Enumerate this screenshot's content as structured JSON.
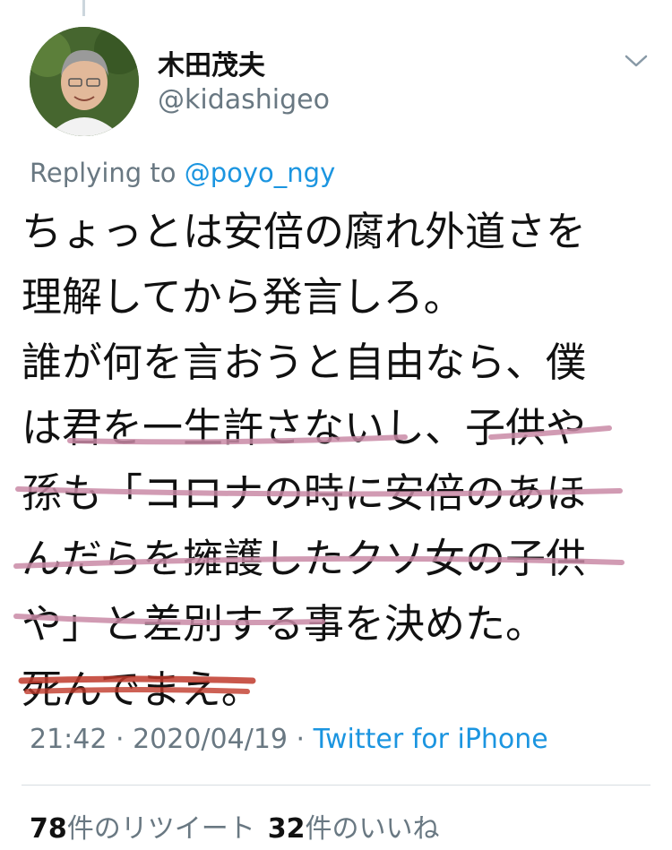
{
  "tweet": {
    "author": {
      "display_name": "木田茂夫",
      "handle": "@kidashigeo"
    },
    "reply": {
      "prefix": "Replying to ",
      "mention": "@poyo_ngy"
    },
    "lines": [
      "ちょっとは安倍の腐れ外道さを",
      "理解してから発言しろ。",
      "誰が何を言おうと自由なら、僕",
      "は君を一生許さないし、子供や",
      "孫も「コロナの時に安倍のあほ",
      "んだらを擁護したクソ女の子供",
      "や」と差別する事を決めた。",
      "死んでまえ。"
    ],
    "meta": {
      "time": "21:42",
      "sep": " · ",
      "date": "2020/04/19",
      "source": "Twitter for iPhone"
    },
    "stats": {
      "retweets": "78",
      "retweets_label": "件のリツイート",
      "likes": "32",
      "likes_label": "件のいいね"
    }
  },
  "colors": {
    "link": "#1b95e0",
    "secondary": "#697882",
    "underline_pink": "#c98aa6",
    "underline_red": "#c0392b"
  },
  "icons": {
    "caret": "chevron-down-icon"
  }
}
